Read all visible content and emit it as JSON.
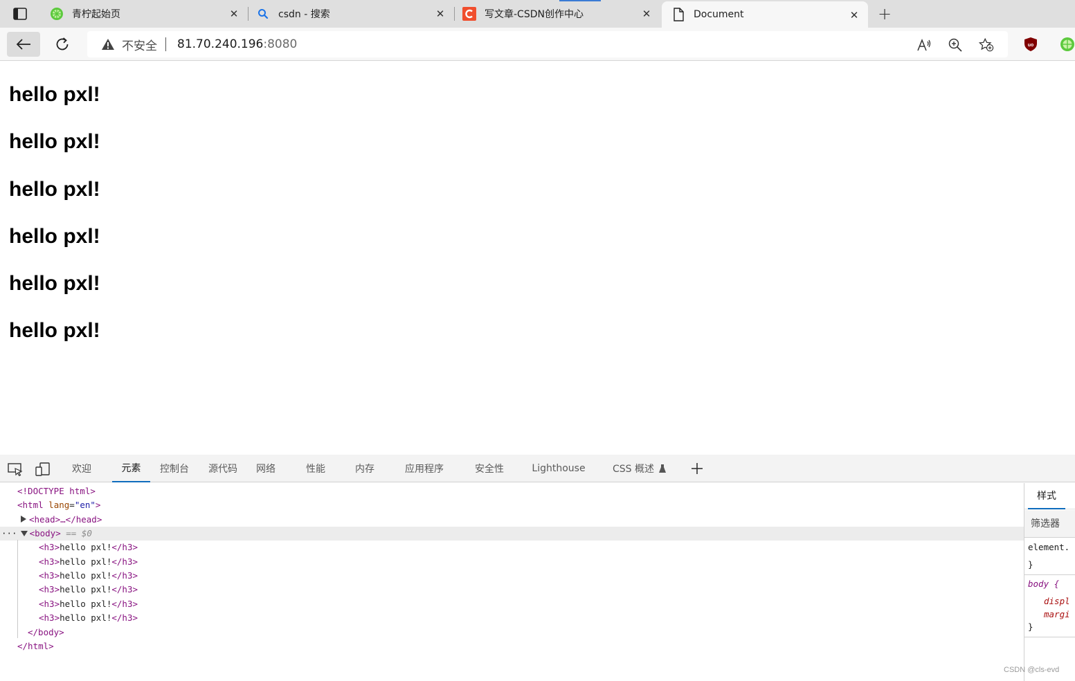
{
  "browser": {
    "tabs": [
      {
        "title": "青柠起始页",
        "icon": "lime-icon",
        "active": false
      },
      {
        "title": "csdn - 搜索",
        "icon": "search-icon",
        "active": false
      },
      {
        "title": "写文章-CSDN创作中心",
        "icon": "csdn-logo-icon",
        "active": false
      },
      {
        "title": "Document",
        "icon": "document-icon",
        "active": true
      }
    ],
    "new_tab_label": "+",
    "close_glyph": "✕",
    "address": {
      "security_label": "不安全",
      "host": "81.70.240.196",
      "port": ":8080"
    }
  },
  "page": {
    "headings": [
      "hello pxl!",
      "hello pxl!",
      "hello pxl!",
      "hello pxl!",
      "hello pxl!",
      "hello pxl!"
    ]
  },
  "devtools": {
    "tabs": [
      "欢迎",
      "元素",
      "控制台",
      "源代码",
      "网络",
      "性能",
      "内存",
      "应用程序",
      "安全性",
      "Lighthouse",
      "CSS 概述"
    ],
    "active_tab": "元素",
    "dom": {
      "doctype": "<!DOCTYPE html>",
      "html_open_tag": "<html",
      "lang_attr": "lang",
      "lang_value": "\"en\"",
      "head_collapsed": "<head>…</head>",
      "body_open": "<body>",
      "selected_marker": "== $0",
      "dots": "···",
      "h3_open": "<h3>",
      "h3_close": "</h3>",
      "h3_text": "hello pxl!",
      "body_close": "</body>",
      "html_close": "</html>"
    },
    "styles": {
      "tab_label": "样式",
      "filter_label": "筛选器",
      "element_style": "element.",
      "rule_selector": "body {",
      "prop1": "displ",
      "prop2": "margi",
      "close_brace": "}"
    }
  },
  "watermark": "CSDN @cls-evd"
}
